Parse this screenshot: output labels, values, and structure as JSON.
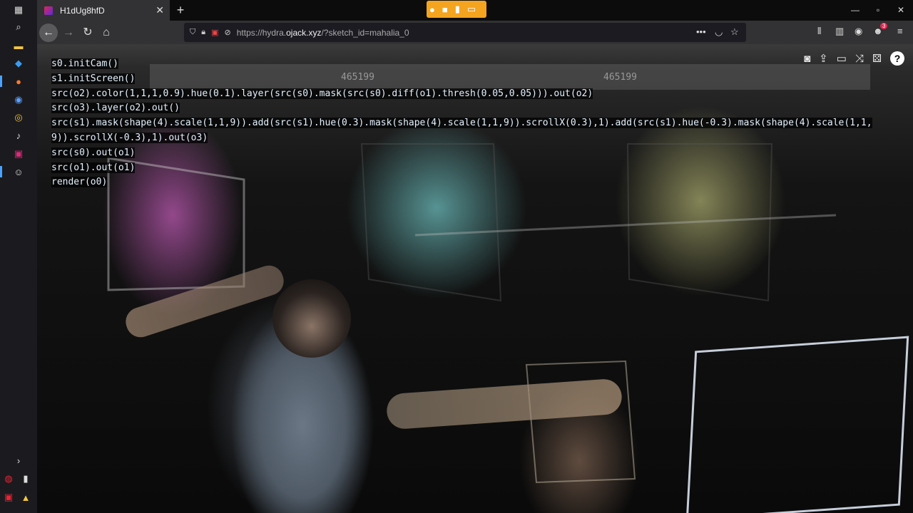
{
  "taskbar": {
    "icons": [
      "windows-start-icon",
      "search-icon",
      "file-explorer-icon",
      "vscode-icon",
      "firefox-icon",
      "browser-icon",
      "chrome-icon",
      "app-icon",
      "app-icon-2",
      "app-icon-3"
    ],
    "bottom_icons": [
      "chevron-right-icon",
      "tray-icon-1",
      "tray-icon-2",
      "tray-icon-3",
      "tray-icon-4"
    ]
  },
  "browser": {
    "tab_title": "H1dUg8hfD",
    "url_prefix": "https://hydra.",
    "url_host": "ojack.xyz",
    "url_path": "/?sketch_id=mahalia_0",
    "notification_count": "3",
    "accent_sharing": "#f4a41f"
  },
  "hud": {
    "counter_left": "465199",
    "counter_right": "465199"
  },
  "code": {
    "lines": [
      "s0.initCam()",
      "s1.initScreen()",
      "src(o2).color(1,1,1,0.9).hue(0.1).layer(src(s0).mask(src(s0).diff(o1).thresh(0.05,0.05))).out(o2)",
      "src(o3).layer(o2).out()",
      "src(s1).mask(shape(4).scale(1,1,9)).add(src(s1).hue(0.3).mask(shape(4).scale(1,1,9)).scrollX(0.3),1).add(src(s1).hue(-0.3).mask(shape(4).scale(1,1,",
      "9)).scrollX(-0.3),1).out(o3)",
      "src(s0).out(o1)",
      "src(o1).out(o1)",
      "render(o0)"
    ]
  },
  "toolbar": {
    "icons": [
      "camera-icon",
      "upload-icon",
      "trash-icon",
      "shuffle-icon",
      "dice-icon"
    ],
    "help_label": "?"
  }
}
